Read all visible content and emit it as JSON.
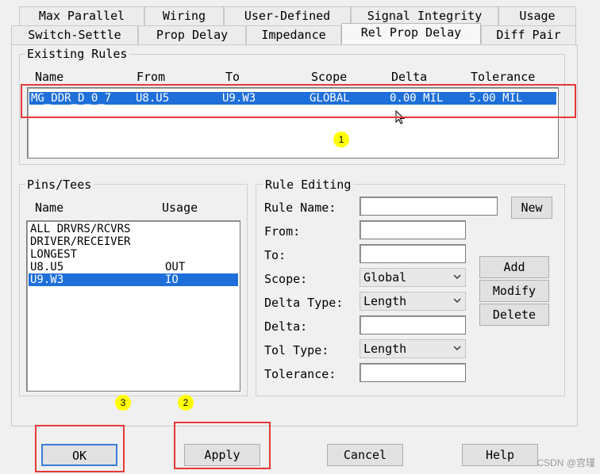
{
  "tabs_row1": [
    {
      "label": "Max Parallel"
    },
    {
      "label": "Wiring"
    },
    {
      "label": "User-Defined"
    },
    {
      "label": "Signal Integrity"
    },
    {
      "label": "Usage"
    }
  ],
  "tabs_row2": [
    {
      "label": "Switch-Settle"
    },
    {
      "label": "Prop Delay"
    },
    {
      "label": "Impedance"
    },
    {
      "label": "Rel Prop Delay"
    },
    {
      "label": "Diff Pair"
    }
  ],
  "existing_rules": {
    "title": "Existing Rules",
    "columns": [
      "Name",
      "From",
      "To",
      "Scope",
      "Delta",
      "Tolerance"
    ],
    "rows": [
      {
        "name": "MG_DDR_D_0_7",
        "from": "U8.U5",
        "to": "U9.W3",
        "scope": "GLOBAL",
        "delta": "0.00 MIL",
        "tolerance": "5.00 MIL"
      }
    ]
  },
  "pins_tees": {
    "title": "Pins/Tees",
    "columns": [
      "Name",
      "Usage"
    ],
    "rows": [
      {
        "name": "ALL DRVRS/RCVRS",
        "usage": ""
      },
      {
        "name": "DRIVER/RECEIVER",
        "usage": ""
      },
      {
        "name": "LONGEST",
        "usage": ""
      },
      {
        "name": "U8.U5",
        "usage": "OUT"
      },
      {
        "name": "U9.W3",
        "usage": "IO"
      }
    ]
  },
  "rule_editing": {
    "title": "Rule Editing",
    "rule_name_label": "Rule Name:",
    "rule_name_value": "",
    "from_label": "From:",
    "to_label": "To:",
    "scope_label": "Scope:",
    "scope_value": "Global",
    "delta_type_label": "Delta Type:",
    "delta_type_value": "Length",
    "delta_label": "Delta:",
    "tol_type_label": "Tol Type:",
    "tol_type_value": "Length",
    "tolerance_label": "Tolerance:",
    "new_label": "New",
    "add_label": "Add",
    "modify_label": "Modify",
    "delete_label": "Delete"
  },
  "markers": {
    "m1": "1",
    "m2": "2",
    "m3": "3"
  },
  "footer": {
    "ok": "OK",
    "apply": "Apply",
    "cancel": "Cancel",
    "help": "Help"
  },
  "watermark": "CSDN @宫瑾",
  "colors": {
    "selection": "#1e6fd9",
    "annotation_red": "#e53935",
    "marker_yellow": "#ffff00"
  }
}
